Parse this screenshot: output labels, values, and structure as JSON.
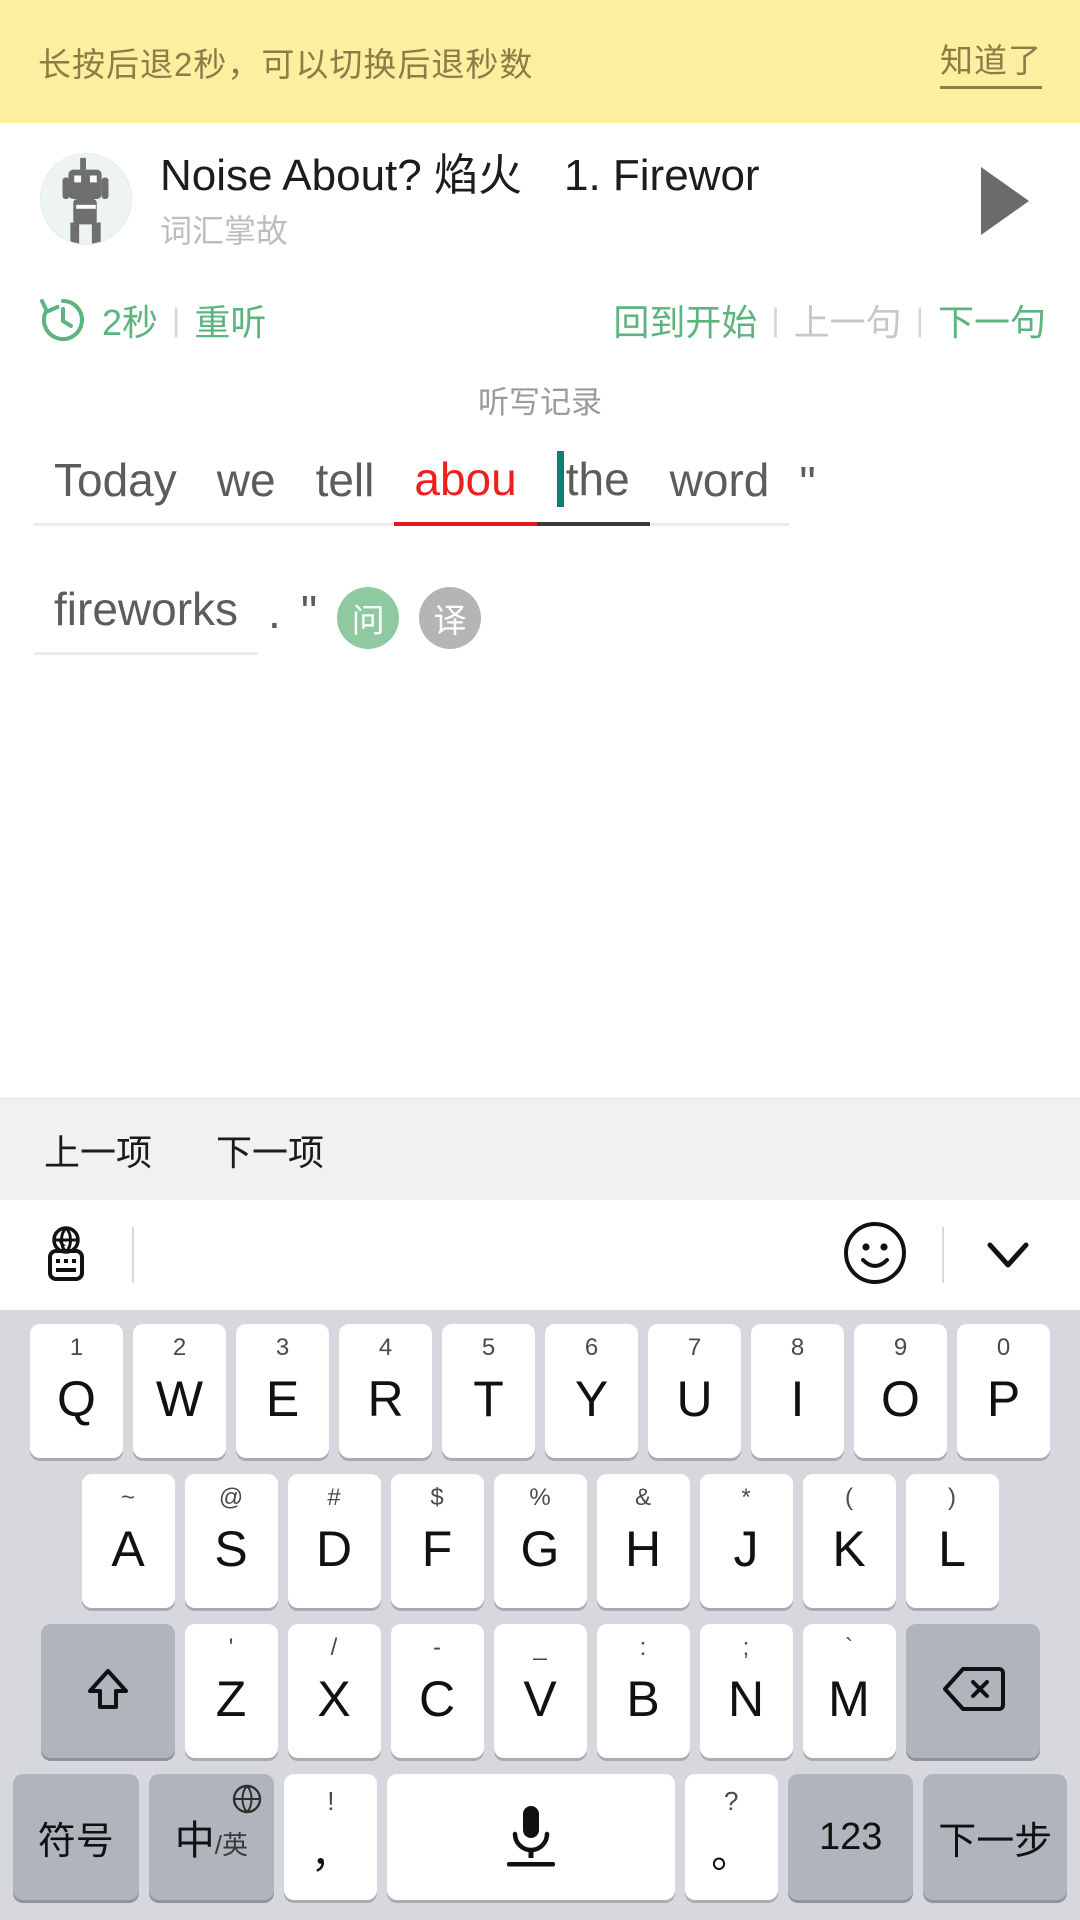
{
  "tip": {
    "message": "长按后退2秒，可以切换后退秒数",
    "action": "知道了"
  },
  "header": {
    "title_main": "Noise About? 焰火",
    "title_seq": "1. Firewor",
    "subtitle": "词汇掌故",
    "play_icon": "play-triangle-icon",
    "avatar_icon": "podcast-avatar"
  },
  "controls": {
    "rewind_icon": "rewind-2s-icon",
    "rewind_label": "2秒",
    "replay": "重听",
    "restart": "回到开始",
    "prev_sentence": "上一句",
    "next_sentence": "下一句",
    "separator": "|"
  },
  "dictation": {
    "section_label": "听写记录",
    "line1": [
      {
        "text": "Today",
        "state": "normal"
      },
      {
        "text": "we",
        "state": "normal"
      },
      {
        "text": "tell",
        "state": "normal"
      },
      {
        "text": "abou",
        "state": "error"
      },
      {
        "text": "the",
        "state": "active"
      },
      {
        "text": "word",
        "state": "normal"
      },
      {
        "text": "\"",
        "state": "punct"
      }
    ],
    "line2": [
      {
        "text": "fireworks",
        "state": "normal"
      },
      {
        "text": ".",
        "state": "punct"
      },
      {
        "text": "\"",
        "state": "punct"
      }
    ],
    "badges": [
      {
        "label": "问",
        "kind": "ask"
      },
      {
        "label": "译",
        "kind": "translate"
      }
    ]
  },
  "nav_toolbar": {
    "prev_item": "上一项",
    "next_item": "下一项"
  },
  "ime_bar": {
    "keyboard_switch_icon": "globe-keyboard-icon",
    "emoji_icon": "smiley-icon",
    "collapse_icon": "chevron-down-icon"
  },
  "keyboard": {
    "row1": [
      {
        "hint": "1",
        "glyph": "Q"
      },
      {
        "hint": "2",
        "glyph": "W"
      },
      {
        "hint": "3",
        "glyph": "E"
      },
      {
        "hint": "4",
        "glyph": "R"
      },
      {
        "hint": "5",
        "glyph": "T"
      },
      {
        "hint": "6",
        "glyph": "Y"
      },
      {
        "hint": "7",
        "glyph": "U"
      },
      {
        "hint": "8",
        "glyph": "I"
      },
      {
        "hint": "9",
        "glyph": "O"
      },
      {
        "hint": "0",
        "glyph": "P"
      }
    ],
    "row2": [
      {
        "hint": "~",
        "glyph": "A"
      },
      {
        "hint": "@",
        "glyph": "S"
      },
      {
        "hint": "#",
        "glyph": "D"
      },
      {
        "hint": "$",
        "glyph": "F"
      },
      {
        "hint": "%",
        "glyph": "G"
      },
      {
        "hint": "&",
        "glyph": "H"
      },
      {
        "hint": "*",
        "glyph": "J"
      },
      {
        "hint": "(",
        "glyph": "K"
      },
      {
        "hint": ")",
        "glyph": "L"
      }
    ],
    "row3": [
      {
        "hint": "",
        "glyph": "",
        "icon": "shift-icon",
        "fn": true
      },
      {
        "hint": "'",
        "glyph": "Z"
      },
      {
        "hint": "/",
        "glyph": "X"
      },
      {
        "hint": "-",
        "glyph": "C"
      },
      {
        "hint": "_",
        "glyph": "V"
      },
      {
        "hint": ":",
        "glyph": "B"
      },
      {
        "hint": ";",
        "glyph": "N"
      },
      {
        "hint": "`",
        "glyph": "M"
      },
      {
        "hint": "",
        "glyph": "",
        "icon": "backspace-icon",
        "fn": true
      }
    ],
    "row4": {
      "symbols": "符号",
      "lang_cn": "中",
      "lang_en": "/英",
      "lang_globe_icon": "globe-icon",
      "punct_left_hint": "!",
      "punct_left_main": "，",
      "space_icon": "mic-icon",
      "punct_right_hint": "?",
      "punct_right_main": "。",
      "numbers": "123",
      "next_step": "下一步"
    }
  }
}
